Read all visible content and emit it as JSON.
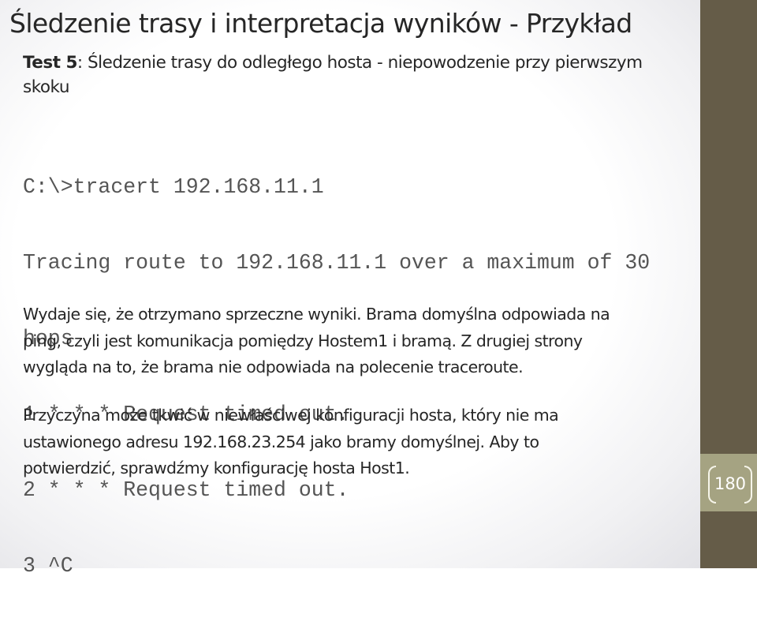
{
  "slide": {
    "title": "Śledzenie trasy i interpretacja wyników - Przykład",
    "subtitle": {
      "label": "Test 5",
      "text": ": Śledzenie trasy do odległego hosta - niepowodzenie przy pierwszym skoku"
    },
    "console_lines": [
      "C:\\>tracert 192.168.11.1",
      "Tracing route to 192.168.11.1 over a maximum of 30",
      "hops",
      "1 * * * Request timed out.",
      "2 * * * Request timed out.",
      "3 ^C"
    ],
    "paragraph1_lines": [
      "Wydaje się, że otrzymano sprzeczne wyniki. Brama domyślna odpowiada na",
      "ping, czyli jest komunikacja pomiędzy Hostem1 i bramą. Z drugiej strony",
      "wygląda na to, że brama nie odpowiada na polecenie traceroute."
    ],
    "paragraph2_lines": [
      "Przyczyna może tkwić w niewłaściwej konfiguracji hosta, który nie ma",
      "ustawionego adresu 192.168.23.254 jako bramy domyślnej. Aby to",
      "potwierdzić, sprawdźmy konfigurację hosta Host1."
    ],
    "page_number": "180"
  },
  "colors": {
    "sidebar": "#655c48",
    "page_band": "#a5a382",
    "text": "#262626",
    "console_text": "#555555"
  }
}
